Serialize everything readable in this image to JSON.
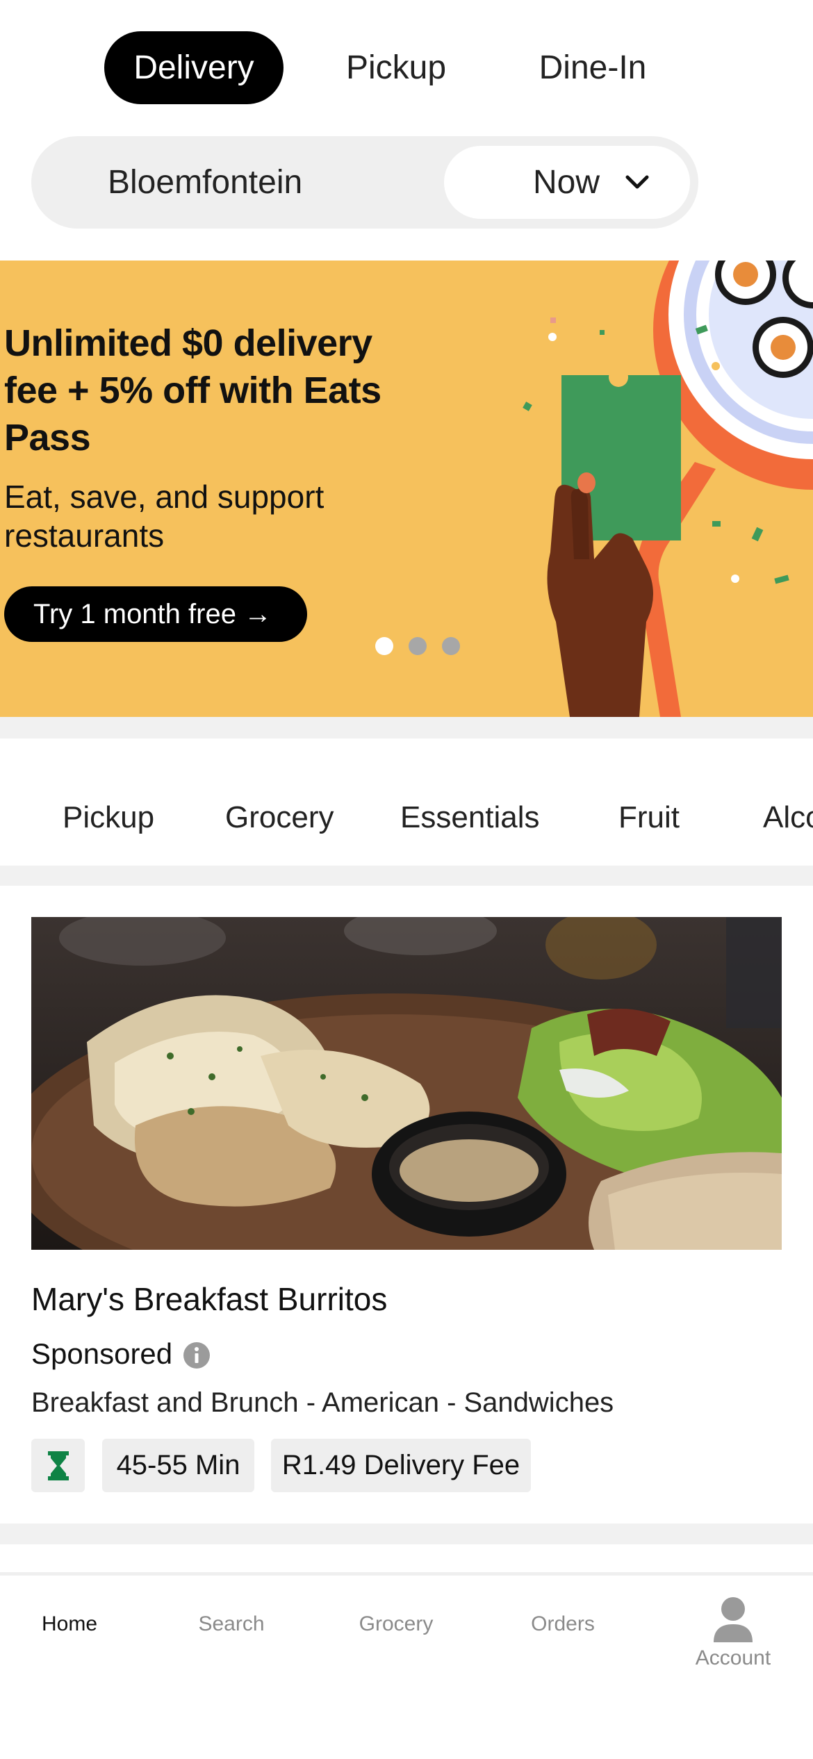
{
  "mode_tabs": [
    {
      "label": "Delivery",
      "active": true
    },
    {
      "label": "Pickup",
      "active": false
    },
    {
      "label": "Dine-In",
      "active": false
    }
  ],
  "location": {
    "city": "Bloemfontein",
    "time": "Now",
    "time_icon": "chevron-down-icon"
  },
  "promo": {
    "title": "Unlimited $0 delivery fee + 5% off with Eats Pass",
    "subtitle": "Eat, save, and support restaurants",
    "cta": "Try 1 month free →",
    "background_color": "#f6c15c",
    "page_indicator": {
      "total": 3,
      "active": 1
    }
  },
  "categories": [
    "Pickup",
    "Grocery",
    "Essentials",
    "Fruit",
    "Alco"
  ],
  "restaurant": {
    "name": "Mary's Breakfast Burritos",
    "sponsored_label": "Sponsored",
    "info_icon": "info-icon",
    "cuisines": "Breakfast and Brunch - American - Sandwiches",
    "badge_icon": "hourglass-icon",
    "eta": "45-55 Min",
    "delivery_fee": "R1.49 Delivery Fee"
  },
  "bottom_nav": {
    "items": [
      {
        "label": "Home",
        "active": true
      },
      {
        "label": "Search",
        "active": false
      },
      {
        "label": "Grocery",
        "active": false
      },
      {
        "label": "Orders",
        "active": false
      },
      {
        "label": "Account",
        "active": false,
        "icon": "person-icon"
      }
    ]
  },
  "colors": {
    "accent": "#000000",
    "promo_yellow": "#f6c15c",
    "badge_green": "#0e8345",
    "inactive_text": "#8a8a8a"
  }
}
